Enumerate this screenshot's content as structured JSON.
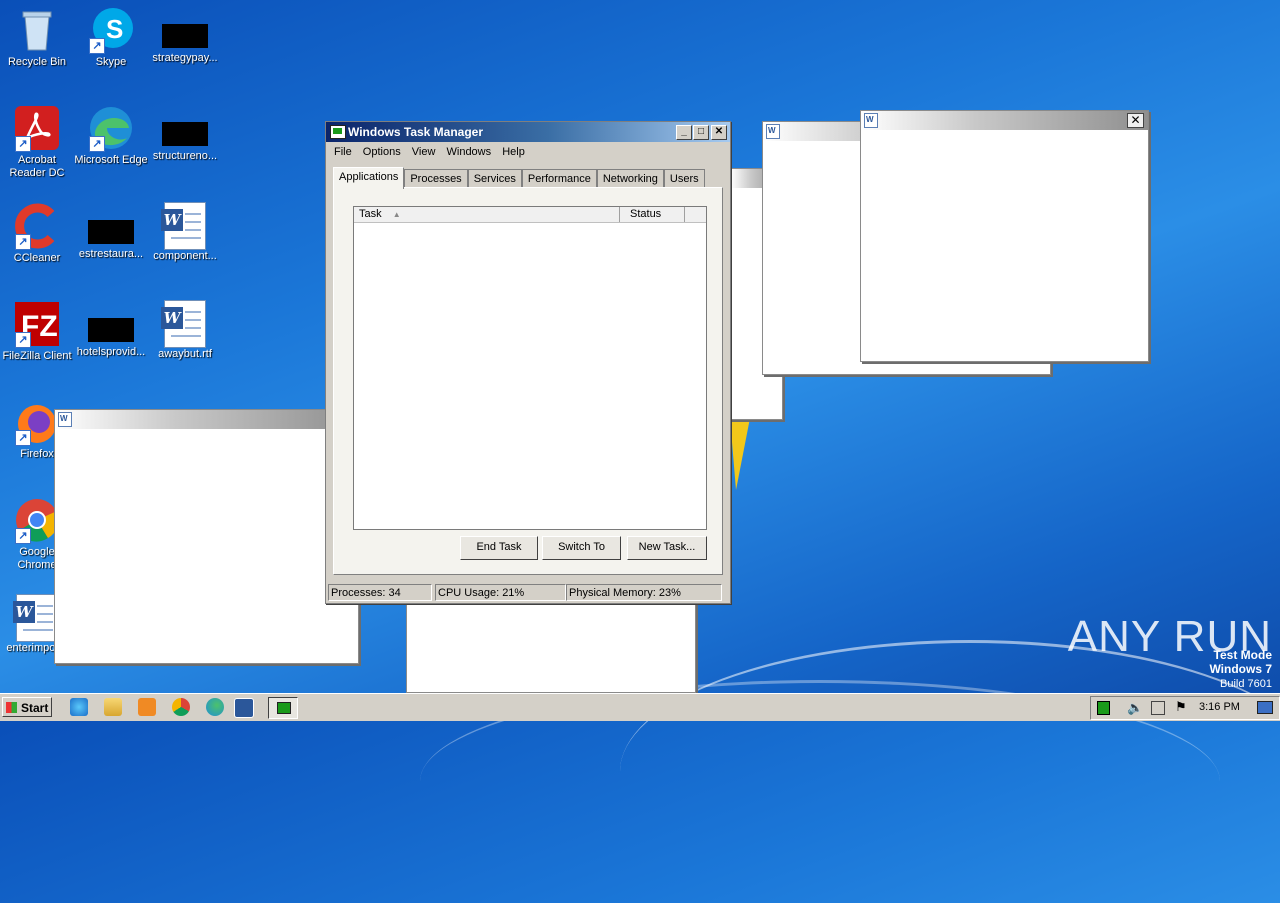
{
  "desktop": {
    "icons": [
      {
        "label": "Recycle Bin"
      },
      {
        "label": "Skype"
      },
      {
        "label": "strategypay..."
      },
      {
        "label": "Acrobat Reader DC"
      },
      {
        "label": "Microsoft Edge"
      },
      {
        "label": "structureno..."
      },
      {
        "label": "CCleaner"
      },
      {
        "label": "estrestaura..."
      },
      {
        "label": "component..."
      },
      {
        "label": "FileZilla Client"
      },
      {
        "label": "hotelsprovid..."
      },
      {
        "label": "awaybut.rtf"
      },
      {
        "label": "Firefox"
      },
      {
        "label": "Google Chrome"
      },
      {
        "label": "enterimpor..."
      }
    ]
  },
  "task_manager": {
    "title": "Windows Task Manager",
    "menu": [
      "File",
      "Options",
      "View",
      "Windows",
      "Help"
    ],
    "tabs": [
      "Applications",
      "Processes",
      "Services",
      "Performance",
      "Networking",
      "Users"
    ],
    "active_tab": "Applications",
    "columns": [
      "Task",
      "Status"
    ],
    "buttons": {
      "end_task": "End Task",
      "switch_to": "Switch To",
      "new_task": "New Task..."
    },
    "status": {
      "processes": "Processes: 34",
      "cpu": "CPU Usage: 21%",
      "memory": "Physical Memory: 23%"
    }
  },
  "taskbar": {
    "start_label": "Start",
    "clock": "3:16 PM"
  },
  "watermark": {
    "brand": "ANY RUN",
    "line1": "Test Mode",
    "line2": "Windows 7",
    "line3": "Build 7601"
  },
  "colors": {
    "desktop": "#1b77d8",
    "window_face": "#d4d0c8",
    "title_active": "#0a246a"
  }
}
